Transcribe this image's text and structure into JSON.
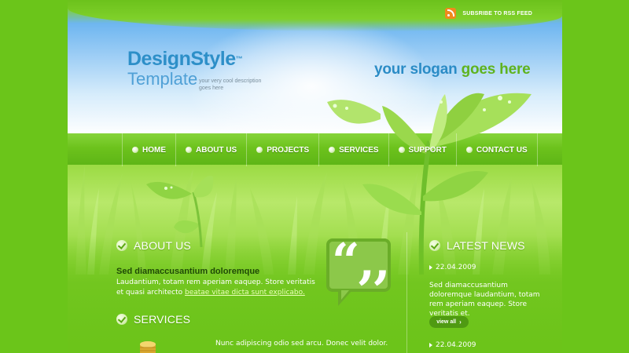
{
  "header": {
    "rss_label": "SUBSRIBE TO RSS FEED",
    "logo_title": "DesignStyle",
    "logo_tm": "™",
    "logo_subtitle": "Template",
    "logo_description": "your very cool description goes here",
    "slogan_part1": "your slogan ",
    "slogan_part2": "goes here"
  },
  "nav": {
    "items": [
      {
        "label": "HOME"
      },
      {
        "label": "ABOUT US"
      },
      {
        "label": "PROJECTS"
      },
      {
        "label": "SERVICES"
      },
      {
        "label": "SUPPORT"
      },
      {
        "label": "CONTACT US"
      }
    ]
  },
  "about": {
    "title": "ABOUT US",
    "heading": "Sed diamaccusantium doloremque",
    "text": "Laudantium, totam rem aperiam eaquep. Store veritatis et quasi architecto ",
    "link": "beatae vitae dicta sunt explicabo."
  },
  "quote": {
    "mark": "“,,"
  },
  "services": {
    "title": "SERVICES",
    "text": "Nunc adipiscing odio sed arcu. Donec velit dolor."
  },
  "news": {
    "title": "LATEST NEWS",
    "items": [
      {
        "date": "22.04.2009",
        "text": "Sed diamaccusantium doloremque laudantium, totam rem aperiam eaquep. Store veritatis et."
      },
      {
        "date": "22.04.2009"
      }
    ],
    "view_all": "view all",
    "view_all_icon": "›"
  },
  "colors": {
    "background": "#6bc51a",
    "logo_blue": "#2d8fc8",
    "slogan_green": "#5fb31e",
    "rss_orange": "#f08a1c"
  }
}
